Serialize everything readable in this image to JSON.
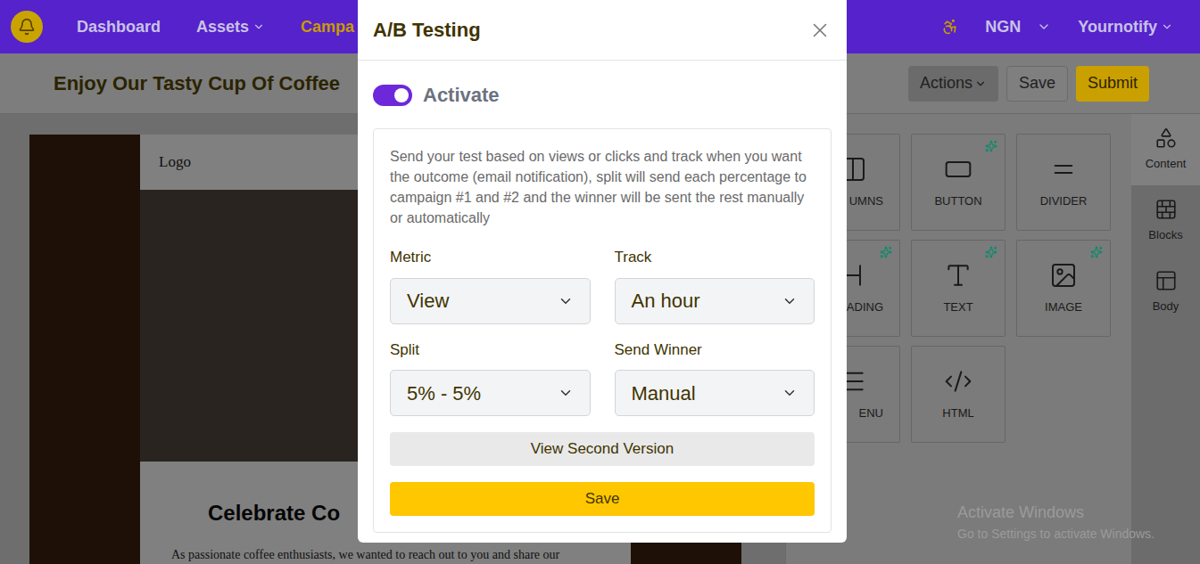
{
  "navbar": {
    "items": [
      {
        "label": "Dashboard",
        "selected": false,
        "dropdown": false
      },
      {
        "label": "Assets",
        "selected": false,
        "dropdown": true
      },
      {
        "label": "Campa",
        "selected": true,
        "dropdown": false
      }
    ],
    "currency": "NGN",
    "account": "Yournotify"
  },
  "toolbar": {
    "title": "Enjoy Our Tasty Cup Of Coffee",
    "buttons": [
      {
        "label": "Actions",
        "kind": "dropdown"
      },
      {
        "label": "Save",
        "kind": "outline"
      },
      {
        "label": "Submit",
        "kind": "primary"
      }
    ]
  },
  "email": {
    "logo": "Logo",
    "heading": "Celebrate Co",
    "paragraph": "As passionate coffee enthusiasts, we wanted to reach out to you and share our"
  },
  "palette": {
    "items": [
      {
        "label": "UMNS",
        "ai": false
      },
      {
        "label": "BUTTON",
        "ai": true
      },
      {
        "label": "DIVIDER",
        "ai": false
      },
      {
        "label": "ADING",
        "ai": true
      },
      {
        "label": "TEXT",
        "ai": true
      },
      {
        "label": "IMAGE",
        "ai": true
      },
      {
        "label": "ENU",
        "ai": false
      },
      {
        "label": "HTML",
        "ai": false
      }
    ]
  },
  "sidebar_tabs": [
    {
      "label": "Content",
      "selected": true
    },
    {
      "label": "Blocks",
      "selected": false
    },
    {
      "label": "Body",
      "selected": false
    }
  ],
  "modal": {
    "title": "A/B Testing",
    "activate": {
      "label": "Activate",
      "on": true
    },
    "description": "Send your test based on views or clicks and track when you want the outcome (email notification), split will send each percentage to campaign #1 and #2 and the winner will be sent the rest manually or automatically",
    "fields": [
      {
        "label": "Metric",
        "value": "View"
      },
      {
        "label": "Track",
        "value": "An hour"
      },
      {
        "label": "Split",
        "value": "5% - 5%"
      },
      {
        "label": "Send Winner",
        "value": "Manual"
      }
    ],
    "buttons": [
      {
        "label": "View Second Version",
        "kind": "secondary"
      },
      {
        "label": "Save",
        "kind": "primary"
      }
    ]
  },
  "watermark": {
    "title": "Activate Windows",
    "subtitle": "Go to Settings to activate Windows."
  }
}
